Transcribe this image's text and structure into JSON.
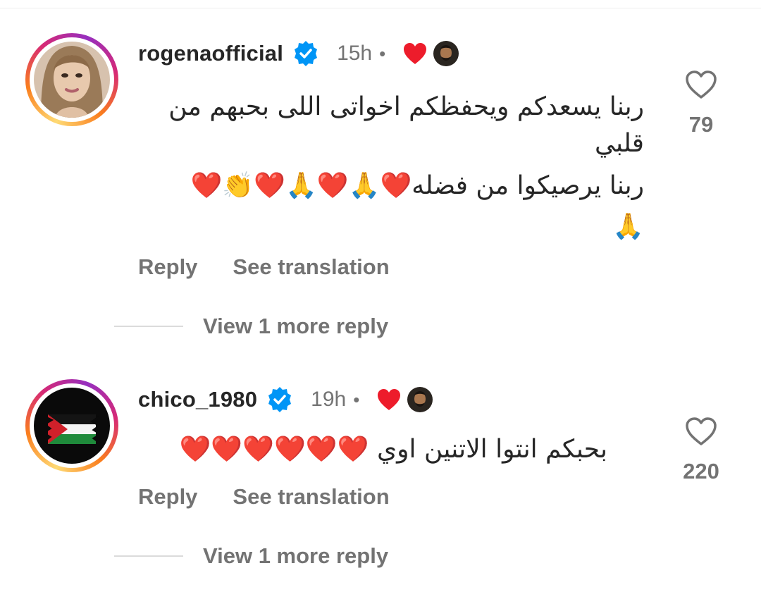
{
  "comments": [
    {
      "username": "rogenaofficial",
      "time": "15h",
      "dot": "•",
      "text_line1": "ربنا يسعدكم ويحفظكم اخواتى اللى بحبهم من",
      "text_line2": "قلبي",
      "text_line3": "ربنا يرصيكوا من فضله❤️🙏❤️🙏❤️👏❤️",
      "text_line4": "🙏",
      "likes": "79",
      "reply_label": "Reply",
      "translate_label": "See translation",
      "view_more_label": "View 1 more reply"
    },
    {
      "username": "chico_1980",
      "time": "19h",
      "dot": "•",
      "text_line1": "بحبكم انتوا الاتنين اوي ❤️❤️❤️❤️❤️❤️",
      "likes": "220",
      "reply_label": "Reply",
      "translate_label": "See translation",
      "view_more_label": "View 1 more reply"
    }
  ],
  "colors": {
    "text": "#262626",
    "secondary": "#737373",
    "verified": "#0095f6",
    "heart": "#ed1c2b"
  },
  "icons": {
    "verified": "verified-badge-icon",
    "liked_by_creator": "heart-filled-icon",
    "like": "heart-outline-icon"
  }
}
